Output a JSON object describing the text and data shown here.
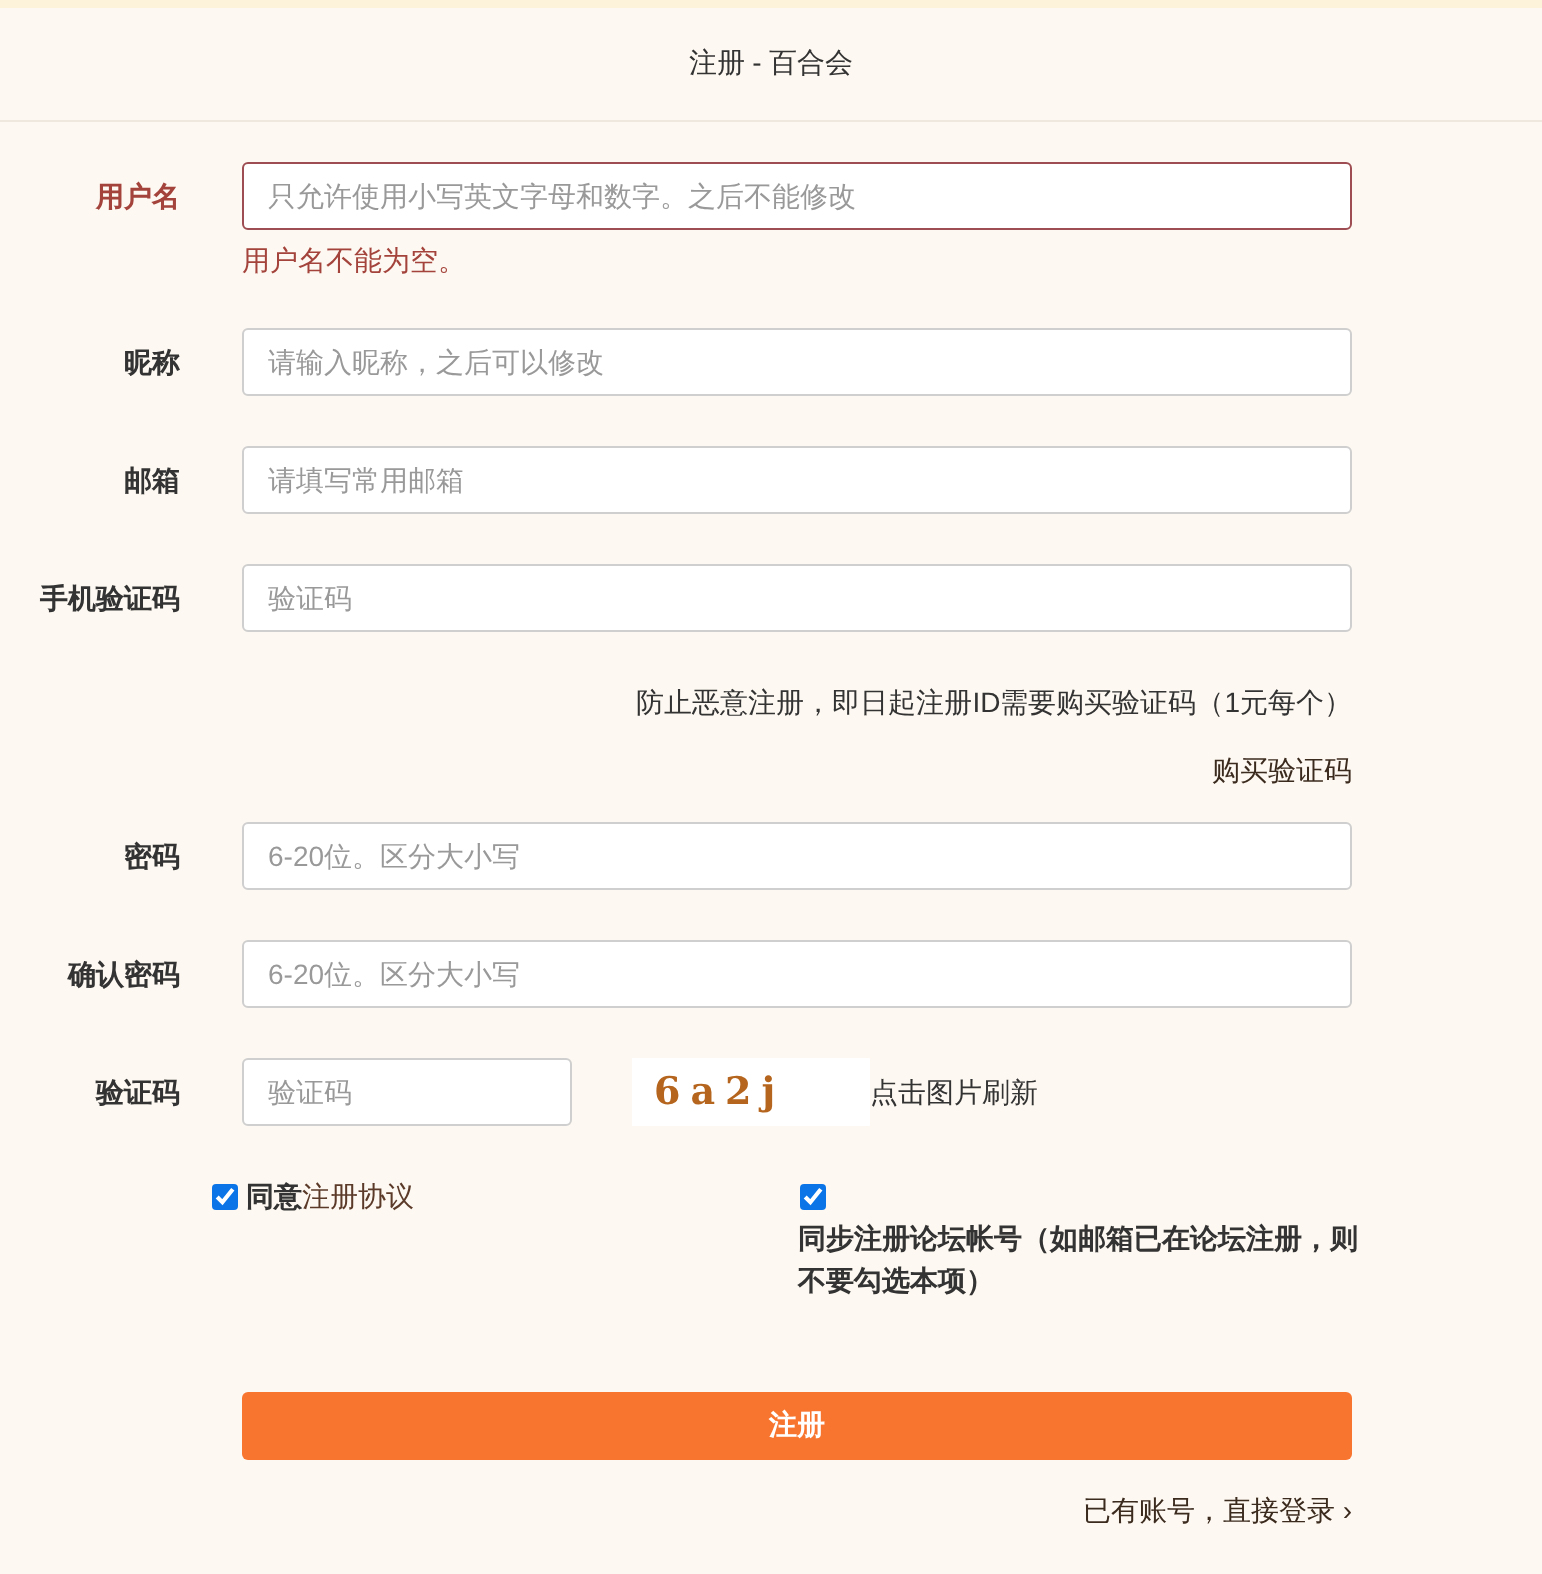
{
  "header": {
    "title": "注册 - 百合会"
  },
  "form": {
    "rows": [
      {
        "kind": "input",
        "label": "用户名",
        "placeholder": "只允许使用小写英文字母和数字。之后不能修改",
        "invalid": true,
        "error": "用户名不能为空。"
      },
      {
        "kind": "input",
        "label": "昵称",
        "placeholder": "请输入昵称，之后可以修改",
        "invalid": false
      },
      {
        "kind": "input",
        "label": "邮箱",
        "placeholder": "请填写常用邮箱",
        "invalid": false
      },
      {
        "kind": "input",
        "label": "手机验证码",
        "placeholder": "验证码",
        "invalid": false
      },
      {
        "kind": "notice",
        "text": "防止恶意注册，即日起注册ID需要购买验证码（1元每个）"
      },
      {
        "kind": "link",
        "text": "购买验证码"
      },
      {
        "kind": "input",
        "label": "密码",
        "placeholder": "6-20位。区分大小写",
        "invalid": false
      },
      {
        "kind": "input",
        "label": "确认密码",
        "placeholder": "6-20位。区分大小写",
        "invalid": false
      },
      {
        "kind": "captcha",
        "label": "验证码",
        "placeholder": "验证码",
        "image_text": "6a2j",
        "hint": "点击图片刷新",
        "invalid": false
      }
    ]
  },
  "checkboxes": [
    {
      "kind": "inline",
      "label": "同意",
      "link": "注册协议",
      "checked": true
    },
    {
      "kind": "stacked",
      "label": "同步注册论坛帐号（如邮箱已在论坛注册，则不要勾选本项）",
      "checked": true
    }
  ],
  "submit": {
    "label": "注册"
  },
  "login_link": {
    "text": "已有账号，直接登录 ›"
  }
}
